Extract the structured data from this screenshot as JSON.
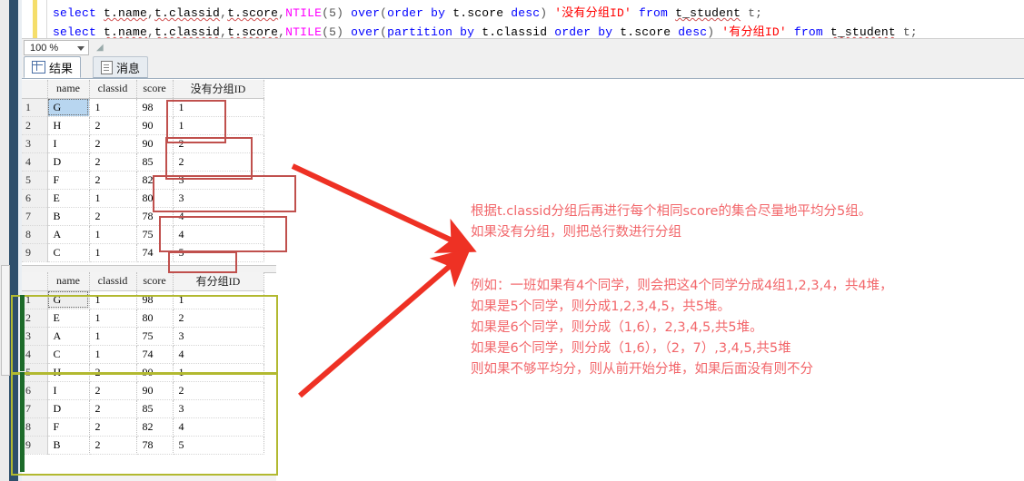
{
  "editor": {
    "line1": {
      "parts": [
        {
          "t": "select ",
          "c": "kw"
        },
        {
          "t": "t.name",
          "c": "id sqg"
        },
        {
          "t": ",",
          "c": "punct"
        },
        {
          "t": "t.classid",
          "c": "id sqg"
        },
        {
          "t": ",",
          "c": "punct"
        },
        {
          "t": "t.score",
          "c": "id sqg"
        },
        {
          "t": ",",
          "c": "punct"
        },
        {
          "t": "NTILE",
          "c": "fn"
        },
        {
          "t": "(5) ",
          "c": "punct"
        },
        {
          "t": "over",
          "c": "kw"
        },
        {
          "t": "(",
          "c": "punct"
        },
        {
          "t": "order by ",
          "c": "kw"
        },
        {
          "t": "t.score ",
          "c": "id"
        },
        {
          "t": "desc",
          "c": "kw"
        },
        {
          "t": ") ",
          "c": "punct"
        },
        {
          "t": "'没有分组ID' ",
          "c": "str"
        },
        {
          "t": "from ",
          "c": "kw"
        },
        {
          "t": "t_student",
          "c": "id sqg"
        },
        {
          "t": " t;",
          "c": "punct"
        }
      ],
      "plain": "select t.name,t.classid,t.score,NTILE(5) over(order by t.score desc) '没有分组ID' from t_student t;"
    },
    "line2": {
      "parts": [
        {
          "t": "select ",
          "c": "kw"
        },
        {
          "t": "t.name",
          "c": "id sqg"
        },
        {
          "t": ",",
          "c": "punct"
        },
        {
          "t": "t.classid",
          "c": "id sqg"
        },
        {
          "t": ",",
          "c": "punct"
        },
        {
          "t": "t.score",
          "c": "id sqg"
        },
        {
          "t": ",",
          "c": "punct"
        },
        {
          "t": "NTILE",
          "c": "fn"
        },
        {
          "t": "(5) ",
          "c": "punct"
        },
        {
          "t": "over",
          "c": "kw"
        },
        {
          "t": "(",
          "c": "punct"
        },
        {
          "t": "partition by ",
          "c": "kw"
        },
        {
          "t": "t.classid ",
          "c": "id"
        },
        {
          "t": "order by ",
          "c": "kw"
        },
        {
          "t": "t.score ",
          "c": "id"
        },
        {
          "t": "desc",
          "c": "kw"
        },
        {
          "t": ") ",
          "c": "punct"
        },
        {
          "t": "'有分组ID' ",
          "c": "str"
        },
        {
          "t": "from ",
          "c": "kw"
        },
        {
          "t": "t_student",
          "c": "id sqg"
        },
        {
          "t": " t;",
          "c": "punct"
        }
      ],
      "plain": "select t.name,t.classid,t.score,NTILE(5) over(partition by t.classid order by t.score desc) '有分组ID' from t_student t;"
    }
  },
  "zoombar": {
    "zoom_value": "100 %",
    "caret": "chevron-down-icon"
  },
  "tabs": [
    {
      "id": "results",
      "label": "结果",
      "icon": "grid-icon",
      "active": true
    },
    {
      "id": "messages",
      "label": "消息",
      "icon": "message-icon",
      "active": false
    }
  ],
  "grid1": {
    "title": "没有分组ID",
    "headers": [
      "",
      "name",
      "classid",
      "score",
      "没有分组ID"
    ],
    "rows": [
      [
        "1",
        "G",
        "1",
        "98",
        "1"
      ],
      [
        "2",
        "H",
        "2",
        "90",
        "1"
      ],
      [
        "3",
        "I",
        "2",
        "90",
        "2"
      ],
      [
        "4",
        "D",
        "2",
        "85",
        "2"
      ],
      [
        "5",
        "F",
        "2",
        "82",
        "3"
      ],
      [
        "6",
        "E",
        "1",
        "80",
        "3"
      ],
      [
        "7",
        "B",
        "2",
        "78",
        "4"
      ],
      [
        "8",
        "A",
        "1",
        "75",
        "4"
      ],
      [
        "9",
        "C",
        "1",
        "74",
        "5"
      ]
    ],
    "selected_cell": {
      "row": 0,
      "col": 1,
      "value": "G"
    }
  },
  "grid2": {
    "title": "有分组ID",
    "headers": [
      "",
      "name",
      "classid",
      "score",
      "有分组ID"
    ],
    "rows": [
      [
        "1",
        "G",
        "1",
        "98",
        "1"
      ],
      [
        "2",
        "E",
        "1",
        "80",
        "2"
      ],
      [
        "3",
        "A",
        "1",
        "75",
        "3"
      ],
      [
        "4",
        "C",
        "1",
        "74",
        "4"
      ],
      [
        "5",
        "H",
        "2",
        "90",
        "1"
      ],
      [
        "6",
        "I",
        "2",
        "90",
        "2"
      ],
      [
        "7",
        "D",
        "2",
        "85",
        "3"
      ],
      [
        "8",
        "F",
        "2",
        "82",
        "4"
      ],
      [
        "9",
        "B",
        "2",
        "78",
        "5"
      ]
    ],
    "selected_cell": {
      "row": 0,
      "col": 1,
      "value": "G"
    }
  },
  "annotations": {
    "red_boxes_label": "ntile-group-brackets",
    "colors": {
      "red_box": "#c0504d",
      "yellow_box": "#b2b930",
      "green_bar": "#1d6b2a",
      "arrow": "#ee3124",
      "note_text": "#f2666a"
    },
    "note_a": [
      "根据t.classid分组后再进行每个相同score的集合尽量地平均分5组。",
      "如果没有分组，则把总行数进行分组"
    ],
    "note_b": [
      "例如：一班如果有4个同学，则会把这4个同学分成4组1,2,3,4，共4堆，",
      "如果是5个同学，则分成1,2,3,4,5，共5堆。",
      "如果是6个同学，则分成（1,6），2,3,4,5,共5堆。",
      "如果是6个同学，则分成（1,6），（2，7）,3,4,5,共5堆",
      "则如果不够平均分，则从前开始分堆，如果后面没有则不分"
    ]
  }
}
